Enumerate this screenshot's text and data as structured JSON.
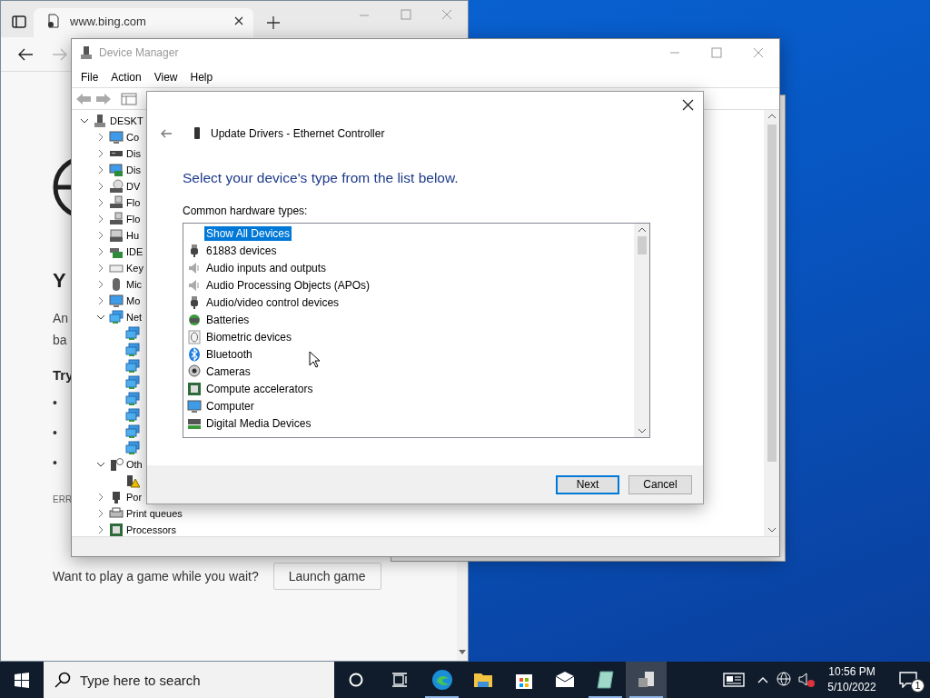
{
  "browser": {
    "tab_title": "www.bing.com",
    "heading": "Y",
    "paragraph_lines": [
      "An",
      "ba"
    ],
    "subheading": "Try",
    "bullets": [
      "•",
      "•",
      "•"
    ],
    "error_code": "ERR",
    "game_prompt": "Want to play a game while you wait?",
    "game_button": "Launch game"
  },
  "device_manager": {
    "title": "Device Manager",
    "menu": [
      "File",
      "Action",
      "View",
      "Help"
    ],
    "tree": {
      "label": "DESKT",
      "kind": "computer",
      "expanded": true,
      "children": [
        {
          "label": "Co",
          "kind": "monitor",
          "expanded": false
        },
        {
          "label": "Dis",
          "kind": "drive",
          "expanded": false
        },
        {
          "label": "Dis",
          "kind": "display",
          "expanded": false
        },
        {
          "label": "DV",
          "kind": "disc",
          "expanded": false
        },
        {
          "label": "Flo",
          "kind": "floppy",
          "expanded": false
        },
        {
          "label": "Flo",
          "kind": "floppy",
          "expanded": false
        },
        {
          "label": "Hu",
          "kind": "hid",
          "expanded": false
        },
        {
          "label": "IDE",
          "kind": "ide",
          "expanded": false
        },
        {
          "label": "Key",
          "kind": "keyboard",
          "expanded": false
        },
        {
          "label": "Mic",
          "kind": "mouse",
          "expanded": false
        },
        {
          "label": "Mo",
          "kind": "monitor",
          "expanded": false
        },
        {
          "label": "Net",
          "kind": "network",
          "expanded": true,
          "children": [
            {
              "kind": "network"
            },
            {
              "kind": "network"
            },
            {
              "kind": "network"
            },
            {
              "kind": "network"
            },
            {
              "kind": "network"
            },
            {
              "kind": "network"
            },
            {
              "kind": "network"
            },
            {
              "kind": "network"
            }
          ]
        },
        {
          "label": "Oth",
          "kind": "other",
          "expanded": true,
          "children": [
            {
              "kind": "warning"
            }
          ]
        },
        {
          "label": "Por",
          "kind": "port",
          "expanded": false
        },
        {
          "label": "Print queues",
          "kind": "printer",
          "expanded": false
        },
        {
          "label": "Processors",
          "kind": "chip",
          "expanded": false
        }
      ]
    }
  },
  "dialog": {
    "title": "Update Drivers - Ethernet Controller",
    "heading": "Select your device's type from the list below.",
    "list_label": "Common hardware types:",
    "items": [
      {
        "label": "Show All Devices",
        "kind": "none",
        "selected": true
      },
      {
        "label": "61883 devices",
        "kind": "plug",
        "selected": false
      },
      {
        "label": "Audio inputs and outputs",
        "kind": "speaker",
        "selected": false
      },
      {
        "label": "Audio Processing Objects (APOs)",
        "kind": "speaker",
        "selected": false
      },
      {
        "label": "Audio/video control devices",
        "kind": "plug",
        "selected": false
      },
      {
        "label": "Batteries",
        "kind": "battery",
        "selected": false
      },
      {
        "label": "Biometric devices",
        "kind": "fingerprint",
        "selected": false
      },
      {
        "label": "Bluetooth",
        "kind": "bluetooth",
        "selected": false
      },
      {
        "label": "Cameras",
        "kind": "camera",
        "selected": false
      },
      {
        "label": "Compute accelerators",
        "kind": "chip",
        "selected": false
      },
      {
        "label": "Computer",
        "kind": "monitor",
        "selected": false
      },
      {
        "label": "Digital Media Devices",
        "kind": "media",
        "selected": false
      }
    ],
    "buttons": [
      {
        "label": "Next",
        "default": true
      },
      {
        "label": "Cancel",
        "default": false
      }
    ]
  },
  "taskbar": {
    "search_placeholder": "Type here to search",
    "apps": [
      {
        "kind": "edge",
        "running": true,
        "selected": false
      },
      {
        "kind": "explorer",
        "running": false,
        "selected": false
      },
      {
        "kind": "store",
        "running": false,
        "selected": false
      },
      {
        "kind": "mail",
        "running": false,
        "selected": false
      },
      {
        "kind": "notepad",
        "running": true,
        "selected": false
      },
      {
        "kind": "devices",
        "running": true,
        "selected": true
      }
    ],
    "time": "10:56 PM",
    "date": "5/10/2022",
    "notification_count": "1"
  }
}
